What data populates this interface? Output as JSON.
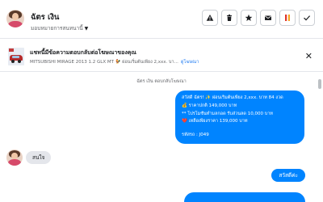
{
  "header": {
    "contact_name": "ฉัตร เงิน",
    "assignee_label": "มอบหมายการสนทนานี้",
    "tools": [
      {
        "icon": "warning-icon"
      },
      {
        "icon": "trash-icon"
      },
      {
        "icon": "star-icon"
      },
      {
        "icon": "envelope-icon"
      },
      {
        "icon": "mark-icon"
      },
      {
        "icon": "check-icon"
      }
    ]
  },
  "ad_banner": {
    "title": "แชทนี้มีข้อความตอบกลับต่อโฆษณาของคุณ",
    "ad_text": "MITSUBISHI MIRAGE 2013 1.2 GLX MT 🐓 ผ่อนเริ่มต้นเพียง 2,xxx. บา...",
    "view_ad_link": "ดูโฆษณา",
    "close_icon": "close-icon"
  },
  "thread": {
    "replied_note": "ฉัตร เงิน ตอบกลับโฆษณา",
    "ad_message_lines": [
      "สวัสดี ฉัตร! ✨ ผ่อนเริ่มต้นเพียง 2,xxx. บาท 84 งวด",
      "💰 ราคาปกติ 149,000 บาท",
      "** โปรโมชั่นทำมลกอด รับส่วนลด 10,000 บาท",
      "❤️ เหลือเพียงราคา 139,000 บาท"
    ],
    "ad_message_code": "รหัสรถ : J049",
    "incoming_message": "สนใจ",
    "outgoing_message": "สวัสดีค่ะ"
  }
}
